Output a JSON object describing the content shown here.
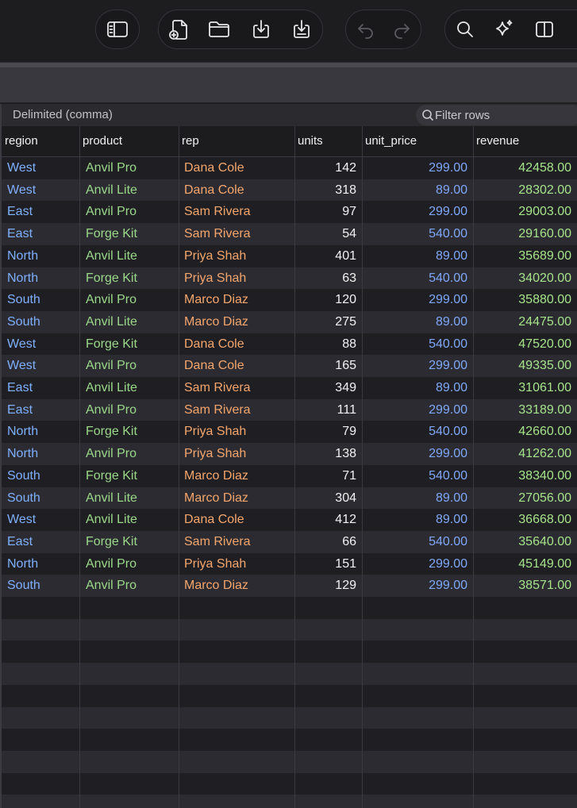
{
  "toolbar": {
    "buttons": [
      {
        "name": "sidebar-toggle-icon",
        "enabled": true
      },
      {
        "name": "new-file-icon",
        "enabled": true
      },
      {
        "name": "open-folder-icon",
        "enabled": true
      },
      {
        "name": "import-icon",
        "enabled": true
      },
      {
        "name": "export-icon",
        "enabled": true
      },
      {
        "name": "undo-icon",
        "enabled": false
      },
      {
        "name": "redo-icon",
        "enabled": false
      },
      {
        "name": "search-icon",
        "enabled": true
      },
      {
        "name": "sparkle-icon",
        "enabled": true
      },
      {
        "name": "split-view-icon",
        "enabled": true
      }
    ]
  },
  "statusbar": {
    "format": "Delimited (comma)",
    "filter_placeholder": "Filter rows"
  },
  "table": {
    "columns": [
      "region",
      "product",
      "rep",
      "units",
      "unit_price",
      "revenue"
    ],
    "rows": [
      [
        "West",
        "Anvil Pro",
        "Dana Cole",
        "142",
        "299.00",
        "42458.00"
      ],
      [
        "West",
        "Anvil Lite",
        "Dana Cole",
        "318",
        "89.00",
        "28302.00"
      ],
      [
        "East",
        "Anvil Pro",
        "Sam Rivera",
        "97",
        "299.00",
        "29003.00"
      ],
      [
        "East",
        "Forge Kit",
        "Sam Rivera",
        "54",
        "540.00",
        "29160.00"
      ],
      [
        "North",
        "Anvil Lite",
        "Priya Shah",
        "401",
        "89.00",
        "35689.00"
      ],
      [
        "North",
        "Forge Kit",
        "Priya Shah",
        "63",
        "540.00",
        "34020.00"
      ],
      [
        "South",
        "Anvil Pro",
        "Marco Diaz",
        "120",
        "299.00",
        "35880.00"
      ],
      [
        "South",
        "Anvil Lite",
        "Marco Diaz",
        "275",
        "89.00",
        "24475.00"
      ],
      [
        "West",
        "Forge Kit",
        "Dana Cole",
        "88",
        "540.00",
        "47520.00"
      ],
      [
        "West",
        "Anvil Pro",
        "Dana Cole",
        "165",
        "299.00",
        "49335.00"
      ],
      [
        "East",
        "Anvil Lite",
        "Sam Rivera",
        "349",
        "89.00",
        "31061.00"
      ],
      [
        "East",
        "Anvil Pro",
        "Sam Rivera",
        "111",
        "299.00",
        "33189.00"
      ],
      [
        "North",
        "Forge Kit",
        "Priya Shah",
        "79",
        "540.00",
        "42660.00"
      ],
      [
        "North",
        "Anvil Pro",
        "Priya Shah",
        "138",
        "299.00",
        "41262.00"
      ],
      [
        "South",
        "Forge Kit",
        "Marco Diaz",
        "71",
        "540.00",
        "38340.00"
      ],
      [
        "South",
        "Anvil Lite",
        "Marco Diaz",
        "304",
        "89.00",
        "27056.00"
      ],
      [
        "West",
        "Anvil Lite",
        "Dana Cole",
        "412",
        "89.00",
        "36668.00"
      ],
      [
        "East",
        "Forge Kit",
        "Sam Rivera",
        "66",
        "540.00",
        "35640.00"
      ],
      [
        "North",
        "Anvil Pro",
        "Priya Shah",
        "151",
        "299.00",
        "45149.00"
      ],
      [
        "South",
        "Anvil Pro",
        "Marco Diaz",
        "129",
        "299.00",
        "38571.00"
      ]
    ]
  },
  "colors": {
    "region": "#7fb0ff",
    "product": "#9bd88a",
    "rep": "#f5a66c",
    "units": "#f2f2f4",
    "unit_price": "#7fa8f8",
    "revenue": "#a6e38a"
  }
}
